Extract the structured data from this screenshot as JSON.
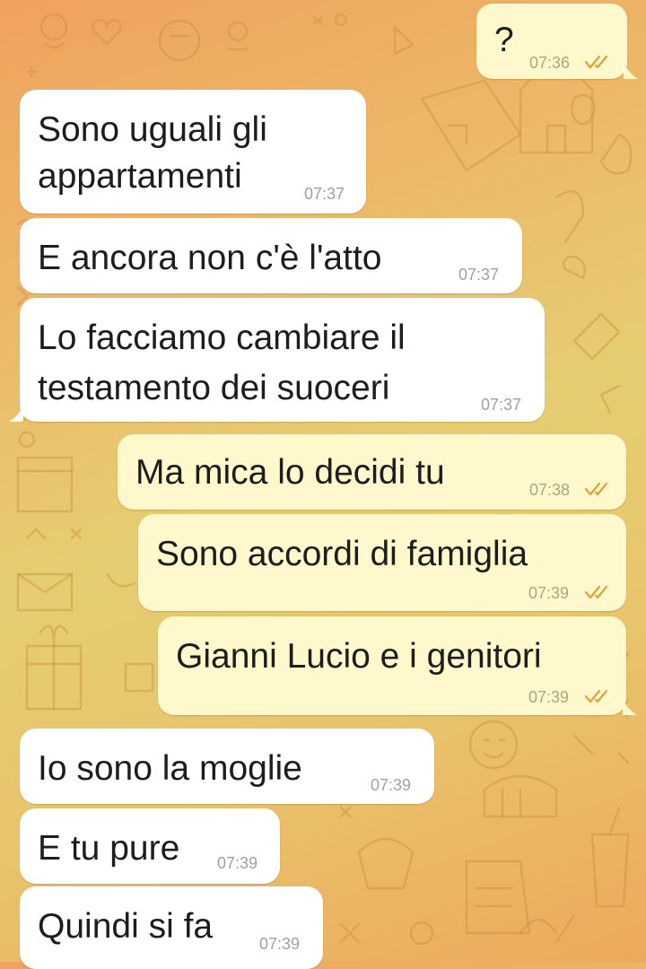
{
  "chat": {
    "messages": [
      {
        "direction": "outgoing",
        "lines": [
          "?"
        ],
        "time": "07:36",
        "status": "read"
      },
      {
        "direction": "incoming",
        "lines": [
          "Sono uguali gli",
          "appartamenti"
        ],
        "time": "07:37"
      },
      {
        "direction": "incoming",
        "lines": [
          "E ancora non c'è l'atto"
        ],
        "time": "07:37"
      },
      {
        "direction": "incoming",
        "lines": [
          "Lo facciamo cambiare il",
          "testamento dei suoceri"
        ],
        "time": "07:37"
      },
      {
        "direction": "outgoing",
        "lines": [
          "Ma mica lo decidi tu"
        ],
        "time": "07:38",
        "status": "read"
      },
      {
        "direction": "outgoing",
        "lines": [
          "Sono accordi di famiglia"
        ],
        "time": "07:39",
        "status": "read"
      },
      {
        "direction": "outgoing",
        "lines": [
          "Gianni Lucio e i genitori"
        ],
        "time": "07:39",
        "status": "read"
      },
      {
        "direction": "incoming",
        "lines": [
          "Io sono la moglie"
        ],
        "time": "07:39"
      },
      {
        "direction": "incoming",
        "lines": [
          "E tu pure"
        ],
        "time": "07:39"
      },
      {
        "direction": "incoming",
        "lines": [
          "Quindi si fa"
        ],
        "time": "07:39"
      }
    ]
  },
  "icons": {
    "read_status": "double-check-icon",
    "wallpaper": "doodle-pattern"
  },
  "colors": {
    "incoming_bubble": "#ffffff",
    "outgoing_bubble": "#fff8cd",
    "read_ticks": "#d9a33a",
    "timestamp": "#a0a0a0"
  }
}
